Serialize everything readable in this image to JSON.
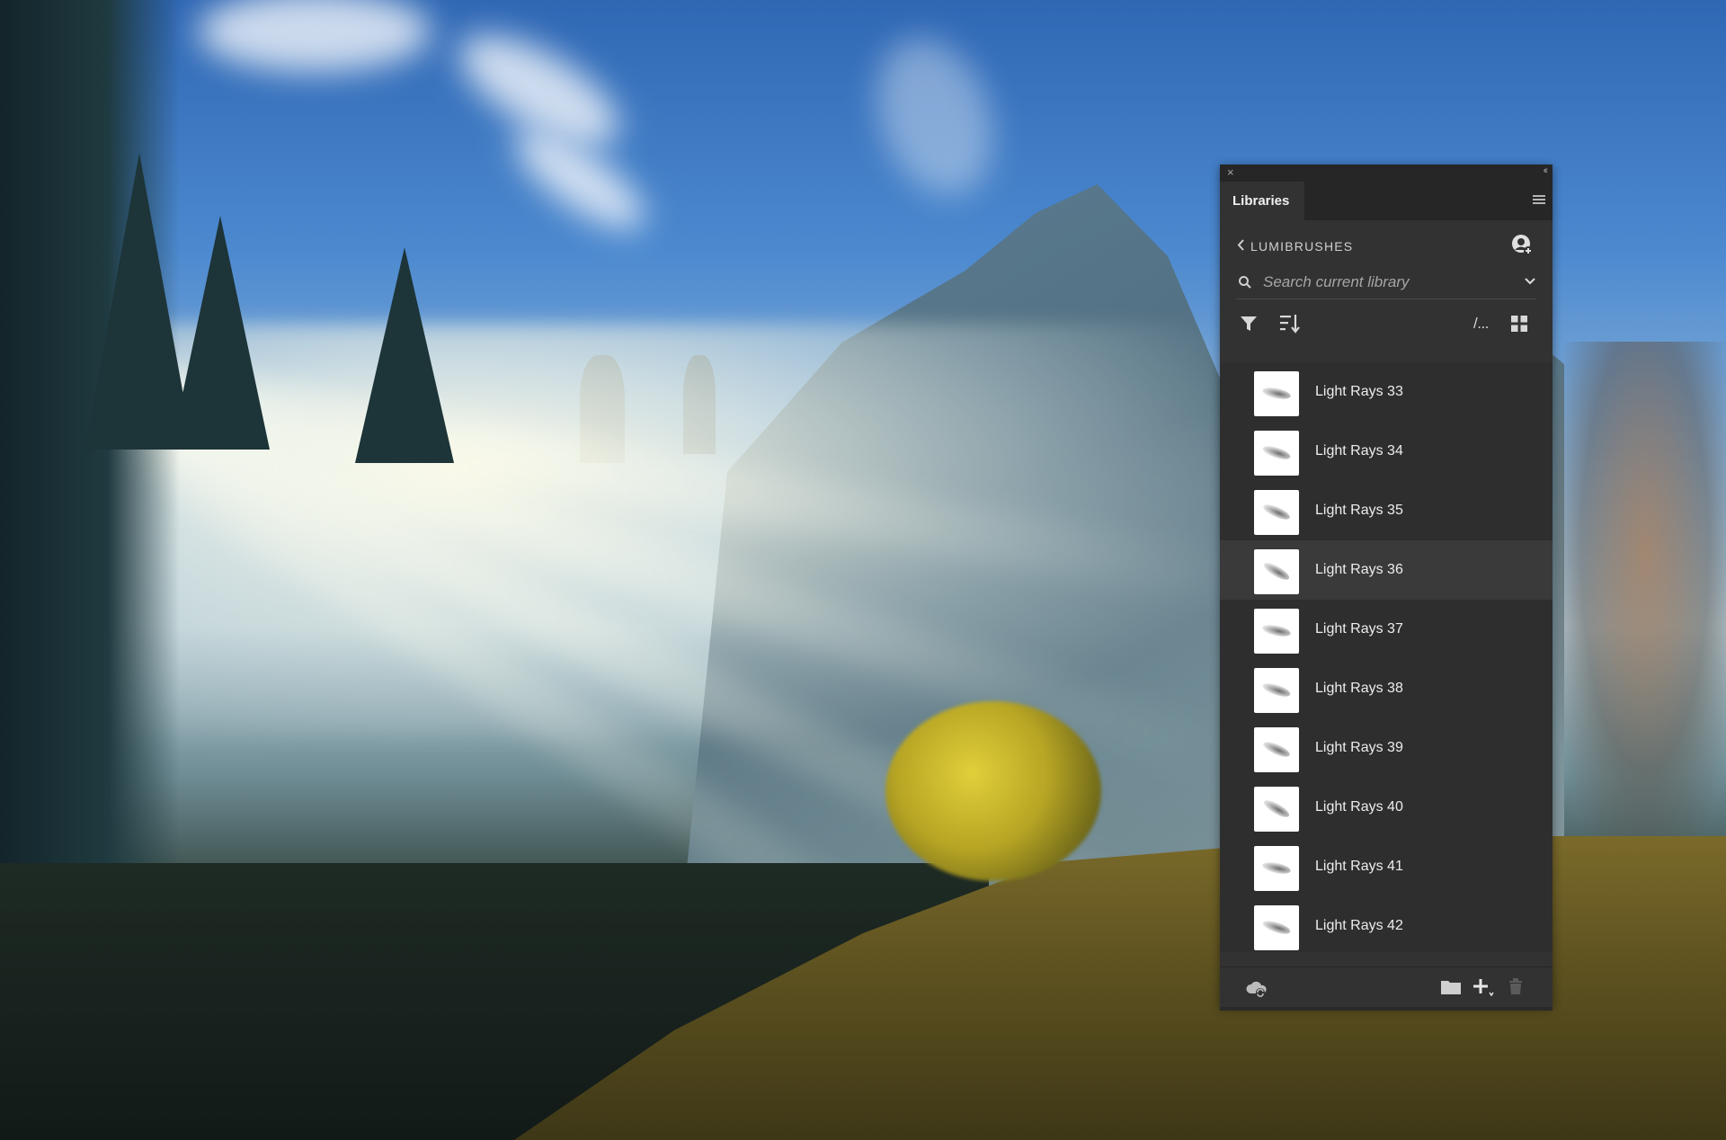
{
  "panel": {
    "close_glyph": "×",
    "collapse_glyph": "‹‹",
    "tab_label": "Libraries",
    "library_name": "LUMIBRUSHES",
    "search": {
      "placeholder": "Search current library",
      "value": ""
    },
    "toolbar": {
      "filter_icon": "filter-icon",
      "sort_icon": "sort-icon",
      "path_label": "/...",
      "grid_icon": "grid-view-icon"
    },
    "items": [
      {
        "label": "Light Rays 33",
        "icon": "brush-thumbnail"
      },
      {
        "label": "Light Rays 34",
        "icon": "brush-thumbnail"
      },
      {
        "label": "Light Rays 35",
        "icon": "brush-thumbnail"
      },
      {
        "label": "Light Rays 36",
        "icon": "brush-thumbnail",
        "selected": true
      },
      {
        "label": "Light Rays 37",
        "icon": "brush-thumbnail"
      },
      {
        "label": "Light Rays 38",
        "icon": "brush-thumbnail"
      },
      {
        "label": "Light Rays 39",
        "icon": "brush-thumbnail"
      },
      {
        "label": "Light Rays 40",
        "icon": "brush-thumbnail"
      },
      {
        "label": "Light Rays 41",
        "icon": "brush-thumbnail"
      },
      {
        "label": "Light Rays 42",
        "icon": "brush-thumbnail"
      }
    ],
    "footer": {
      "sync_icon": "cloud-sync-icon",
      "folder_icon": "folder-icon",
      "add_icon": "add-icon",
      "delete_icon": "trash-icon"
    },
    "colors": {
      "panel_bg": "#323232",
      "title_bg": "#262626",
      "list_bg": "#2e2e2e",
      "selected_row": "#3a3a3a",
      "text": "#e6e6e6"
    }
  }
}
